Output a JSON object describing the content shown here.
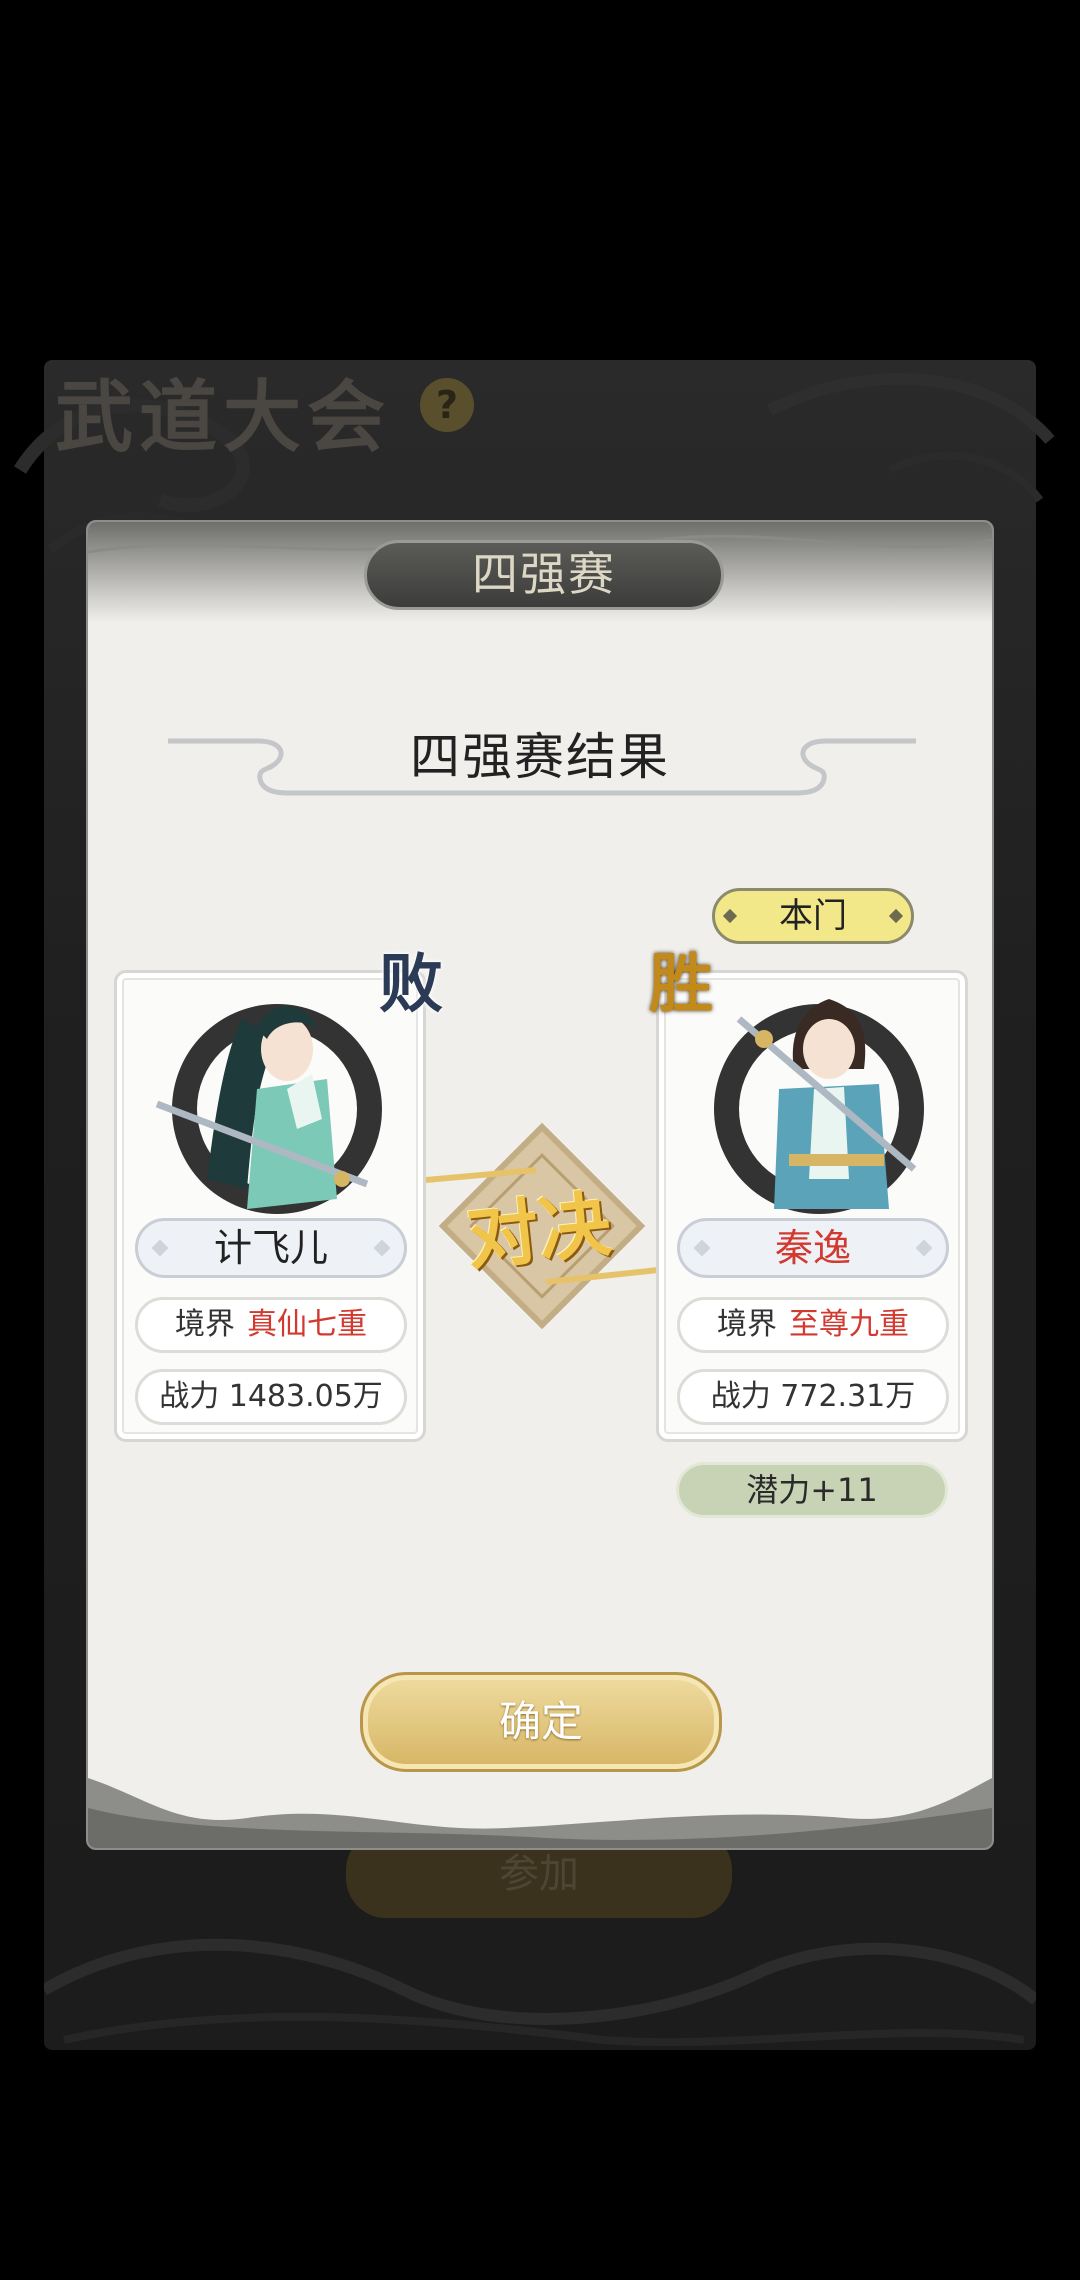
{
  "background": {
    "title": "武道大会",
    "help_glyph": "?",
    "join_label": "参加"
  },
  "modal": {
    "tab_title": "四强赛",
    "result_title": "四强赛结果",
    "vs_label": "对决",
    "confirm_label": "确定"
  },
  "loser": {
    "badge": "败",
    "name": "计飞儿",
    "realm_label": "境界",
    "realm_value": "真仙七重",
    "power_label": "战力 1483.05万"
  },
  "winner": {
    "badge": "胜",
    "sect_tag": "本门",
    "name": "秦逸",
    "realm_label": "境界",
    "realm_value": "至尊九重",
    "power_label": "战力 772.31万",
    "potential": "潜力+11"
  },
  "colors": {
    "accent_red": "#d2392f",
    "gold": "#d6b564",
    "sect_yellow": "#f3e889",
    "potential_green": "#c8d3b6"
  }
}
